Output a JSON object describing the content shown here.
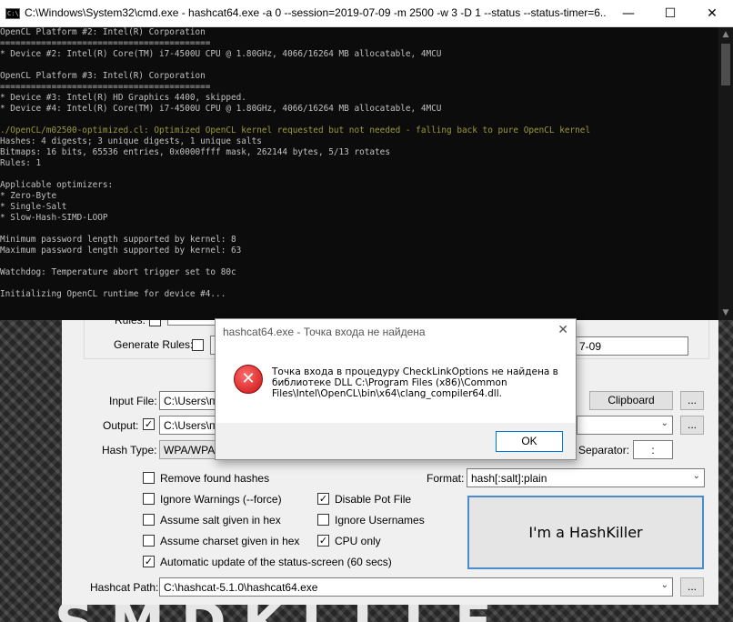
{
  "console": {
    "title": "C:\\Windows\\System32\\cmd.exe - hashcat64.exe  -a 0 --session=2019-07-09 -m 2500 -w 3 -D 1 --status --status-timer=6...",
    "icon_text": "C:\\",
    "controls": {
      "minimize": "—",
      "maximize": "☐",
      "close": "✕"
    },
    "lines": [
      "OpenCL Platform #2: Intel(R) Corporation",
      "=========================================",
      "* Device #2: Intel(R) Core(TM) i7-4500U CPU @ 1.80GHz, 4066/16264 MB allocatable, 4MCU",
      "",
      "OpenCL Platform #3: Intel(R) Corporation",
      "=========================================",
      "* Device #3: Intel(R) HD Graphics 4400, skipped.",
      "* Device #4: Intel(R) Core(TM) i7-4500U CPU @ 1.80GHz, 4066/16264 MB allocatable, 4MCU",
      "",
      "./OpenCL/m02500-optimized.cl: Optimized OpenCL kernel requested but not needed - falling back to pure OpenCL kernel",
      "Hashes: 4 digests; 3 unique digests, 1 unique salts",
      "Bitmaps: 16 bits, 65536 entries, 0x0000ffff mask, 262144 bytes, 5/13 rotates",
      "Rules: 1",
      "",
      "Applicable optimizers:",
      "* Zero-Byte",
      "* Single-Salt",
      "* Slow-Hash-SIMD-LOOP",
      "",
      "Minimum password length supported by kernel: 8",
      "Maximum password length supported by kernel: 63",
      "",
      "Watchdog: Temperature abort trigger set to 80c",
      "",
      "Initializing OpenCL runtime for device #4..."
    ],
    "scroll_up": "▲",
    "scroll_down": "▼"
  },
  "app": {
    "rules_label": "Rules:",
    "generate_rules_label": "Generate Rules:",
    "session_value": "7-09",
    "input_file_label": "Input File:",
    "input_file_value": "C:\\Users\\пл",
    "clipboard_button": "Clipboard",
    "browse_button": "...",
    "output_label": "Output:",
    "output_value": "C:\\Users\\пл",
    "hash_type_label": "Hash Type:",
    "hash_type_value": "WPA/WPA",
    "separator_label": "Separator:",
    "separator_value": ":",
    "format_label": "Format:",
    "format_value": "hash[:salt]:plain",
    "options": {
      "remove_found": "Remove found hashes",
      "ignore_warnings": "Ignore Warnings (--force)",
      "disable_pot": "Disable Pot File",
      "salt_hex": "Assume salt given in hex",
      "ignore_usernames": "Ignore Usernames",
      "charset_hex": "Assume charset given in hex",
      "cpu_only": "CPU only",
      "auto_update": "Automatic update of the status-screen (60 secs)"
    },
    "hashkiller_button": "I'm a HashKiller",
    "hashcat_path_label": "Hashcat Path:",
    "hashcat_path_value": "C:\\hashcat-5.1.0\\hashcat64.exe",
    "background_text": "SMDKLLLF"
  },
  "dialog": {
    "title": "hashcat64.exe - Точка входа не найдена",
    "close": "✕",
    "icon": "✕",
    "message": "Точка входа в процедуру CheckLinkOptions не найдена в библиотеке DLL C:\\Program Files (x86)\\Common Files\\Intel\\OpenCL\\bin\\x64\\clang_compiler64.dll.",
    "ok_button": "OK"
  },
  "colors": {
    "console_bg": "#0c0c0c",
    "console_text": "#c0c0c0",
    "console_warning": "#9a9a3c",
    "accent_border": "#4a8bcc",
    "error_red": "#c81212"
  }
}
